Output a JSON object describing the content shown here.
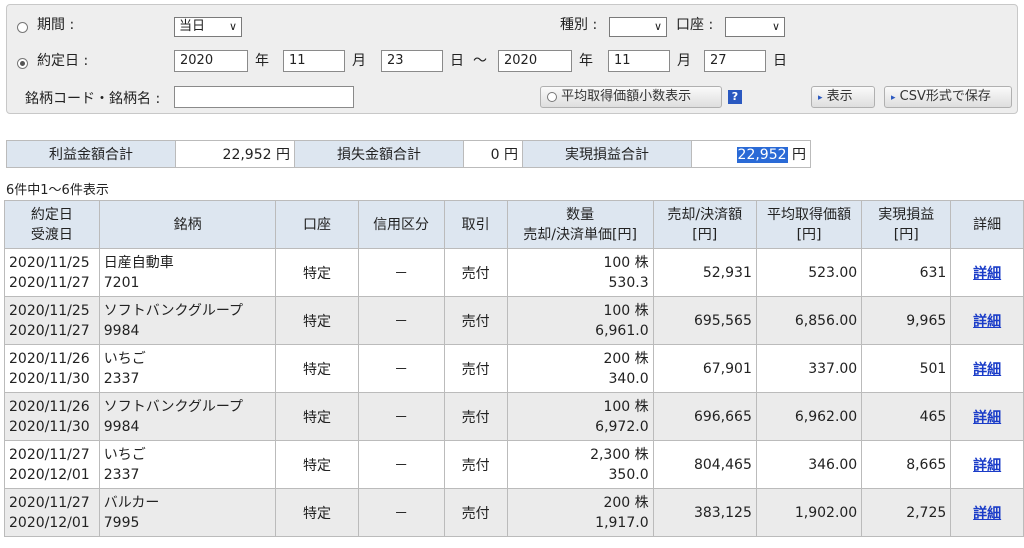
{
  "filters": {
    "period_label": "期間 :",
    "period_value": "当日",
    "trade_date_label": "約定日 :",
    "from": {
      "year": "2020",
      "month": "11",
      "day": "23"
    },
    "to": {
      "year": "2020",
      "month": "11",
      "day": "27"
    },
    "unit_year": "年",
    "unit_month": "月",
    "unit_day": "日",
    "tilde": "～",
    "type_label": "種別 :",
    "type_value": "",
    "account_label": "口座 :",
    "account_value": "",
    "code_label": "銘柄コード・銘柄名 :",
    "code_value": "",
    "avg_decimal_label": "平均取得価額小数表示",
    "help_icon": "?",
    "show_label": "表示",
    "csv_label": "CSV形式で保存"
  },
  "summary": {
    "profit_label": "利益金額合計",
    "profit_value": "22,952",
    "loss_label": "損失金額合計",
    "loss_value": "0",
    "realized_label": "実現損益合計",
    "realized_value": "22,952",
    "yen": "円"
  },
  "count_text": "6件中1～6件表示",
  "table": {
    "headers": {
      "date1": "約定日",
      "date2": "受渡日",
      "name": "銘柄",
      "account": "口座",
      "margin": "信用区分",
      "trade": "取引",
      "qty1": "数量",
      "qty2": "売却/決済単価[円]",
      "sale1": "売却/決済額",
      "sale2": "[円]",
      "avg1": "平均取得価額",
      "avg2": "[円]",
      "pl1": "実現損益",
      "pl2": "[円]",
      "detail": "詳細"
    },
    "rows": [
      {
        "trade_date": "2020/11/25",
        "settle_date": "2020/11/27",
        "name": "日産自動車",
        "code": "7201",
        "account": "特定",
        "margin": "－",
        "trade": "売付",
        "qty": "100 株",
        "price": "530.3",
        "amount": "52,931",
        "avg": "523.00",
        "pl": "631",
        "detail": "詳細"
      },
      {
        "trade_date": "2020/11/25",
        "settle_date": "2020/11/27",
        "name": "ソフトバンクグループ",
        "code": "9984",
        "account": "特定",
        "margin": "－",
        "trade": "売付",
        "qty": "100 株",
        "price": "6,961.0",
        "amount": "695,565",
        "avg": "6,856.00",
        "pl": "9,965",
        "detail": "詳細"
      },
      {
        "trade_date": "2020/11/26",
        "settle_date": "2020/11/30",
        "name": "いちご",
        "code": "2337",
        "account": "特定",
        "margin": "－",
        "trade": "売付",
        "qty": "200 株",
        "price": "340.0",
        "amount": "67,901",
        "avg": "337.00",
        "pl": "501",
        "detail": "詳細"
      },
      {
        "trade_date": "2020/11/26",
        "settle_date": "2020/11/30",
        "name": "ソフトバンクグループ",
        "code": "9984",
        "account": "特定",
        "margin": "－",
        "trade": "売付",
        "qty": "100 株",
        "price": "6,972.0",
        "amount": "696,665",
        "avg": "6,962.00",
        "pl": "465",
        "detail": "詳細"
      },
      {
        "trade_date": "2020/11/27",
        "settle_date": "2020/12/01",
        "name": "いちご",
        "code": "2337",
        "account": "特定",
        "margin": "－",
        "trade": "売付",
        "qty": "2,300 株",
        "price": "350.0",
        "amount": "804,465",
        "avg": "346.00",
        "pl": "8,665",
        "detail": "詳細"
      },
      {
        "trade_date": "2020/11/27",
        "settle_date": "2020/12/01",
        "name": "バルカー",
        "code": "7995",
        "account": "特定",
        "margin": "－",
        "trade": "売付",
        "qty": "200 株",
        "price": "1,917.0",
        "amount": "383,125",
        "avg": "1,902.00",
        "pl": "2,725",
        "detail": "詳細"
      }
    ]
  }
}
